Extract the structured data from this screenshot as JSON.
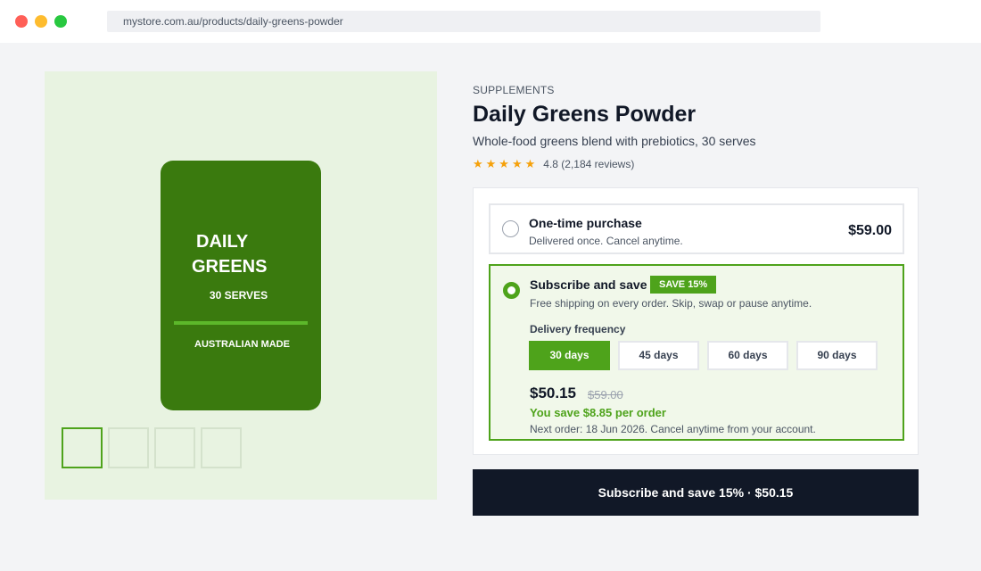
{
  "browser": {
    "url": "mystore.com.au/products/daily-greens-powder"
  },
  "gallery": {
    "pack_line1": "DAILY",
    "pack_line2": "GREENS",
    "pack_serves": "30 SERVES",
    "pack_made": "AUSTRALIAN MADE",
    "pack_color": "#3a7a0e",
    "thumbnail_count": 4,
    "active_thumbnail": 1
  },
  "product": {
    "category": "SUPPLEMENTS",
    "title": "Daily Greens Powder",
    "subtitle": "Whole-food greens blend with prebiotics, 30 serves",
    "stars": "★★★★★",
    "rating_text": "4.8 (2,184 reviews)"
  },
  "purchase_options": {
    "one_time": {
      "title": "One-time purchase",
      "description": "Delivered once. Cancel anytime.",
      "price": "$59.00",
      "selected": false
    },
    "subscribe": {
      "title": "Subscribe and save",
      "badge": "SAVE 15%",
      "description": "Free shipping on every order. Skip, swap or pause anytime.",
      "frequency_label": "Delivery frequency",
      "frequencies": [
        "30 days",
        "45 days",
        "60 days",
        "90 days"
      ],
      "selected_frequency": "30 days",
      "price": "$50.15",
      "original_price": "$59.00",
      "savings": "You save $8.85 per order",
      "next_order": "Next order: 18 Jun 2026. Cancel anytime from your account.",
      "selected": true
    }
  },
  "cta": {
    "label": "Subscribe and save 15%  ·  $50.15"
  },
  "colors": {
    "accent_green": "#4ea31b",
    "cta_background": "#111827",
    "star": "#f5a10b"
  }
}
